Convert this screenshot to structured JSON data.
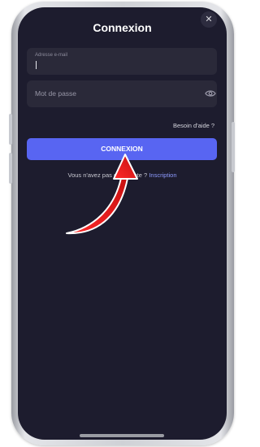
{
  "dialog": {
    "title": "Connexion",
    "close_symbol": "✕"
  },
  "form": {
    "email": {
      "label": "Adresse e-mail",
      "value": ""
    },
    "password": {
      "placeholder": "Mot de passe",
      "toggle_icon": "eye-icon"
    },
    "help_link": "Besoin d'aide ?",
    "submit_label": "CONNEXION",
    "signup_prompt": "Vous n'avez pas de compte ? ",
    "signup_link": "Inscription"
  },
  "colors": {
    "background": "#1d1c2e",
    "field": "#2a2939",
    "accent": "#5865f2",
    "link": "#8e9bff",
    "annotation_arrow": "#e11d1d"
  }
}
